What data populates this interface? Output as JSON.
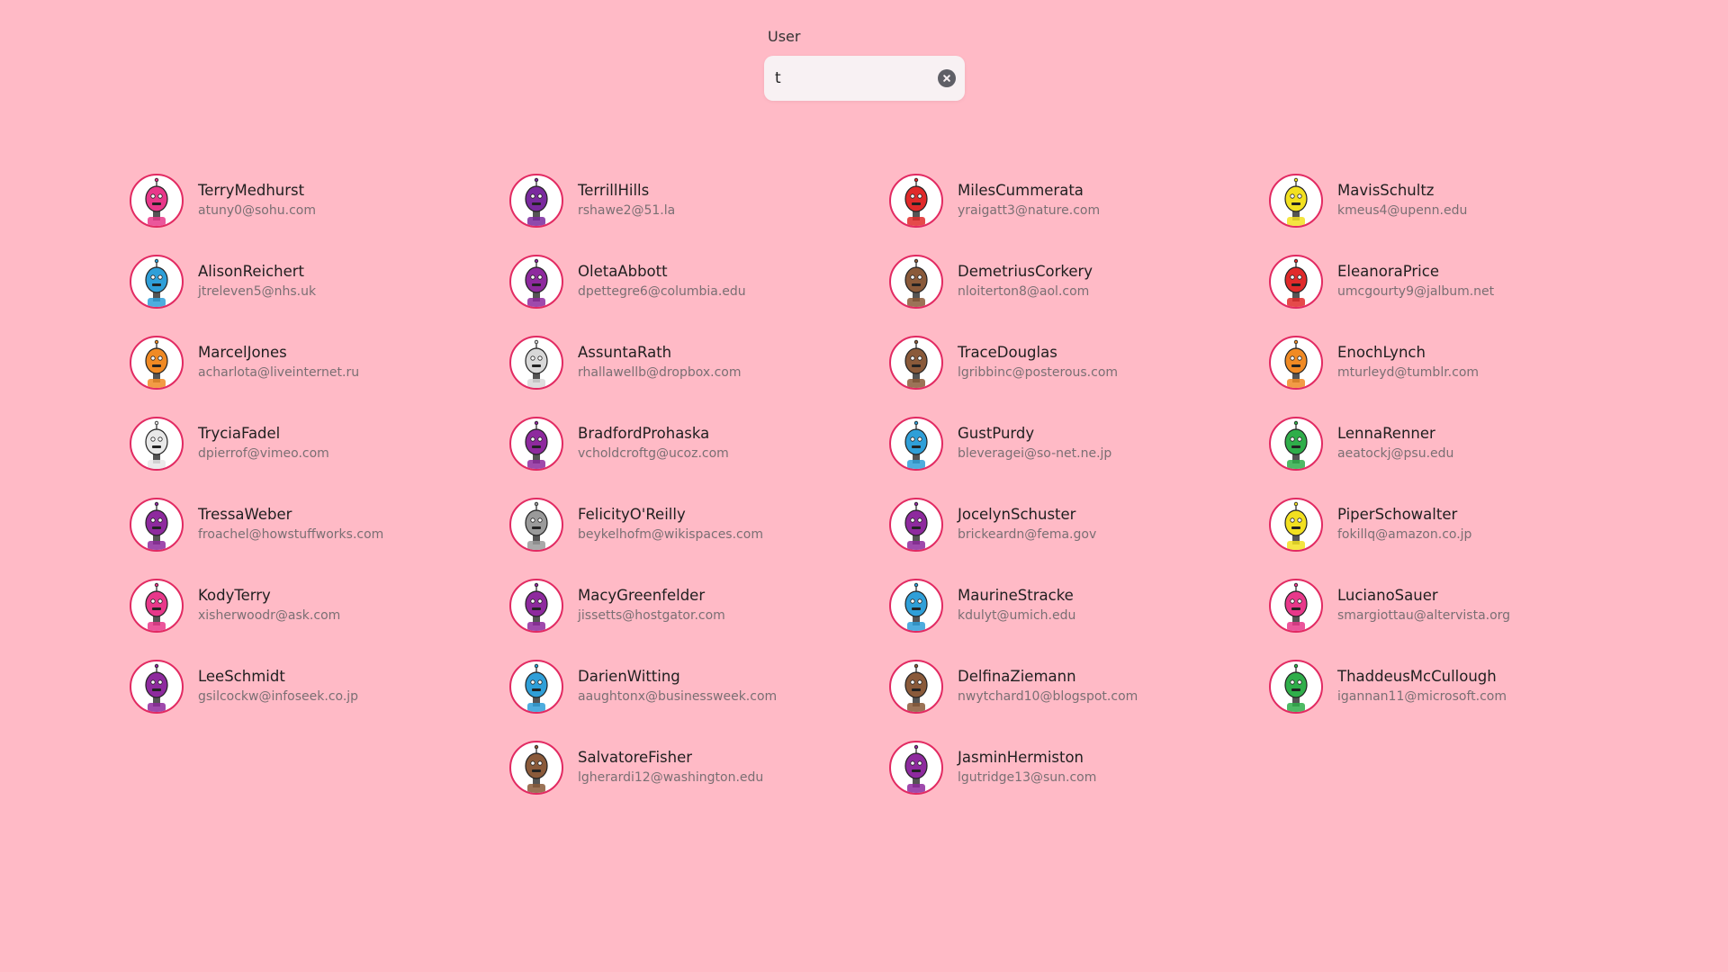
{
  "search": {
    "label": "User",
    "value": "t",
    "clear_icon": "clear-circle-icon"
  },
  "colors": {
    "background": "#ffbac6",
    "avatar_ring": "#e22a62",
    "name_text": "#1f1f1f",
    "email_text": "#7a6f73"
  },
  "users": [
    {
      "name": "TerryMedhurst",
      "email": "atuny0@sohu.com",
      "color": "#e8388a"
    },
    {
      "name": "AlisonReichert",
      "email": "jtreleven5@nhs.uk",
      "color": "#2f9fd8"
    },
    {
      "name": "MarcelJones",
      "email": "acharlota@liveinternet.ru",
      "color": "#f08a24"
    },
    {
      "name": "TryciaFadel",
      "email": "dpierrof@vimeo.com",
      "color": "#e8e8e8"
    },
    {
      "name": "TressaWeber",
      "email": "froachel@howstuffworks.com",
      "color": "#8e2a9e"
    },
    {
      "name": "KodyTerry",
      "email": "xisherwoodr@ask.com",
      "color": "#e8388a"
    },
    {
      "name": "LeeSchmidt",
      "email": "gsilcockw@infoseek.co.jp",
      "color": "#8e2a9e"
    },
    {
      "name": "TerrillHills",
      "email": "rshawe2@51.la",
      "color": "#7a2a9e"
    },
    {
      "name": "OletaAbbott",
      "email": "dpettegre6@columbia.edu",
      "color": "#8e2a9e"
    },
    {
      "name": "AssuntaRath",
      "email": "rhallawellb@dropbox.com",
      "color": "#d8d8d8"
    },
    {
      "name": "BradfordProhaska",
      "email": "vcholdcroftg@ucoz.com",
      "color": "#8e2a9e"
    },
    {
      "name": "FelicityO'Reilly",
      "email": "beykelhofm@wikispaces.com",
      "color": "#9a9a9a"
    },
    {
      "name": "MacyGreenfelder",
      "email": "jissetts@hostgator.com",
      "color": "#8e2a9e"
    },
    {
      "name": "DarienWitting",
      "email": "aaughtonx@businessweek.com",
      "color": "#2f9fd8"
    },
    {
      "name": "SalvatoreFisher",
      "email": "lgherardi12@washington.edu",
      "color": "#8a5a3a"
    },
    {
      "name": "MilesCummerata",
      "email": "yraigatt3@nature.com",
      "color": "#e02a2a"
    },
    {
      "name": "DemetriusCorkery",
      "email": "nloiterton8@aol.com",
      "color": "#8a5a3a"
    },
    {
      "name": "TraceDouglas",
      "email": "lgribbinc@posterous.com",
      "color": "#8a5a3a"
    },
    {
      "name": "GustPurdy",
      "email": "bleveragei@so-net.ne.jp",
      "color": "#2f9fd8"
    },
    {
      "name": "JocelynSchuster",
      "email": "brickeardn@fema.gov",
      "color": "#8e2a9e"
    },
    {
      "name": "MaurineStracke",
      "email": "kdulyt@umich.edu",
      "color": "#2f9fd8"
    },
    {
      "name": "DelfinaZiemann",
      "email": "nwytchard10@blogspot.com",
      "color": "#8a5a3a"
    },
    {
      "name": "JasminHermiston",
      "email": "lgutridge13@sun.com",
      "color": "#8e2a9e"
    },
    {
      "name": "MavisSchultz",
      "email": "kmeus4@upenn.edu",
      "color": "#f2e020"
    },
    {
      "name": "EleanoraPrice",
      "email": "umcgourty9@jalbum.net",
      "color": "#e02a2a"
    },
    {
      "name": "EnochLynch",
      "email": "mturleyd@tumblr.com",
      "color": "#f08a24"
    },
    {
      "name": "LennaRenner",
      "email": "aeatockj@psu.edu",
      "color": "#2fae4a"
    },
    {
      "name": "PiperSchowalter",
      "email": "fokillq@amazon.co.jp",
      "color": "#f2e020"
    },
    {
      "name": "LucianoSauer",
      "email": "smargiottau@altervista.org",
      "color": "#e8388a"
    },
    {
      "name": "ThaddeusMcCullough",
      "email": "igannan11@microsoft.com",
      "color": "#2fae4a"
    }
  ]
}
